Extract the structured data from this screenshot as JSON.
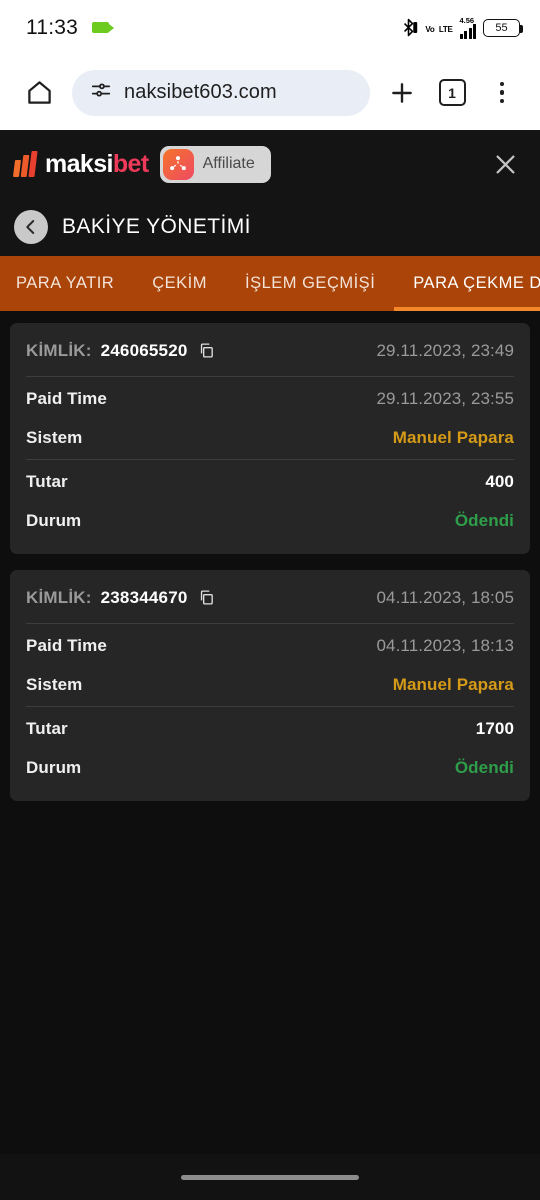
{
  "status_bar": {
    "time": "11:33",
    "camera_icon": "camera-recording-icon",
    "bluetooth_icon": "bluetooth-off-icon",
    "volte_line1": "Vo",
    "volte_line2": "LTE",
    "data_rate": "4.56",
    "signal_icon": "signal-bars-icon",
    "battery_percent": "55"
  },
  "browser": {
    "home_icon": "home-icon",
    "site_settings_icon": "site-settings-tune-icon",
    "url": "naksibet603.com",
    "new_tab_icon": "plus-icon",
    "tab_count": "1",
    "menu_icon": "overflow-menu-icon"
  },
  "banner": {
    "logo_text_primary": "maksi",
    "logo_text_accent": "bet",
    "logo_mark_icon": "maksibet-chevrons-icon",
    "affiliate_icon": "affiliate-network-icon",
    "affiliate_label": "Affiliate",
    "close_icon": "close-icon"
  },
  "header": {
    "back_icon": "chevron-left-icon",
    "title": "BAKİYE YÖNETİMİ"
  },
  "tabs": [
    {
      "label": "PARA YATIR",
      "active": false
    },
    {
      "label": "ÇEKİM",
      "active": false
    },
    {
      "label": "İŞLEM GEÇMİŞİ",
      "active": false
    },
    {
      "label": "PARA ÇEKME DURUMU",
      "active": true
    }
  ],
  "labels": {
    "kimlik": "KİMLİK:",
    "paid_time": "Paid Time",
    "sistem": "Sistem",
    "tutar": "Tutar",
    "durum": "Durum",
    "copy_icon": "copy-icon"
  },
  "colors": {
    "page_bg": "#0e0e0e",
    "card_bg": "#262626",
    "tabbar_bg": "#ab4409",
    "tab_active_underline": "#f4872a",
    "gold": "#d59a17",
    "green": "#2e9e4a",
    "muted_text": "#9a9a9a",
    "brand_accent": "#ee3a5a"
  },
  "records": [
    {
      "kimlik": "246065520",
      "created": "29.11.2023, 23:49",
      "paid_time": "29.11.2023, 23:55",
      "sistem": "Manuel Papara",
      "tutar": "400",
      "durum": "Ödendi"
    },
    {
      "kimlik": "238344670",
      "created": "04.11.2023, 18:05",
      "paid_time": "04.11.2023, 18:13",
      "sistem": "Manuel Papara",
      "tutar": "1700",
      "durum": "Ödendi"
    }
  ],
  "nav_bar": {
    "gesture_pill": "gesture-navigation-pill"
  }
}
